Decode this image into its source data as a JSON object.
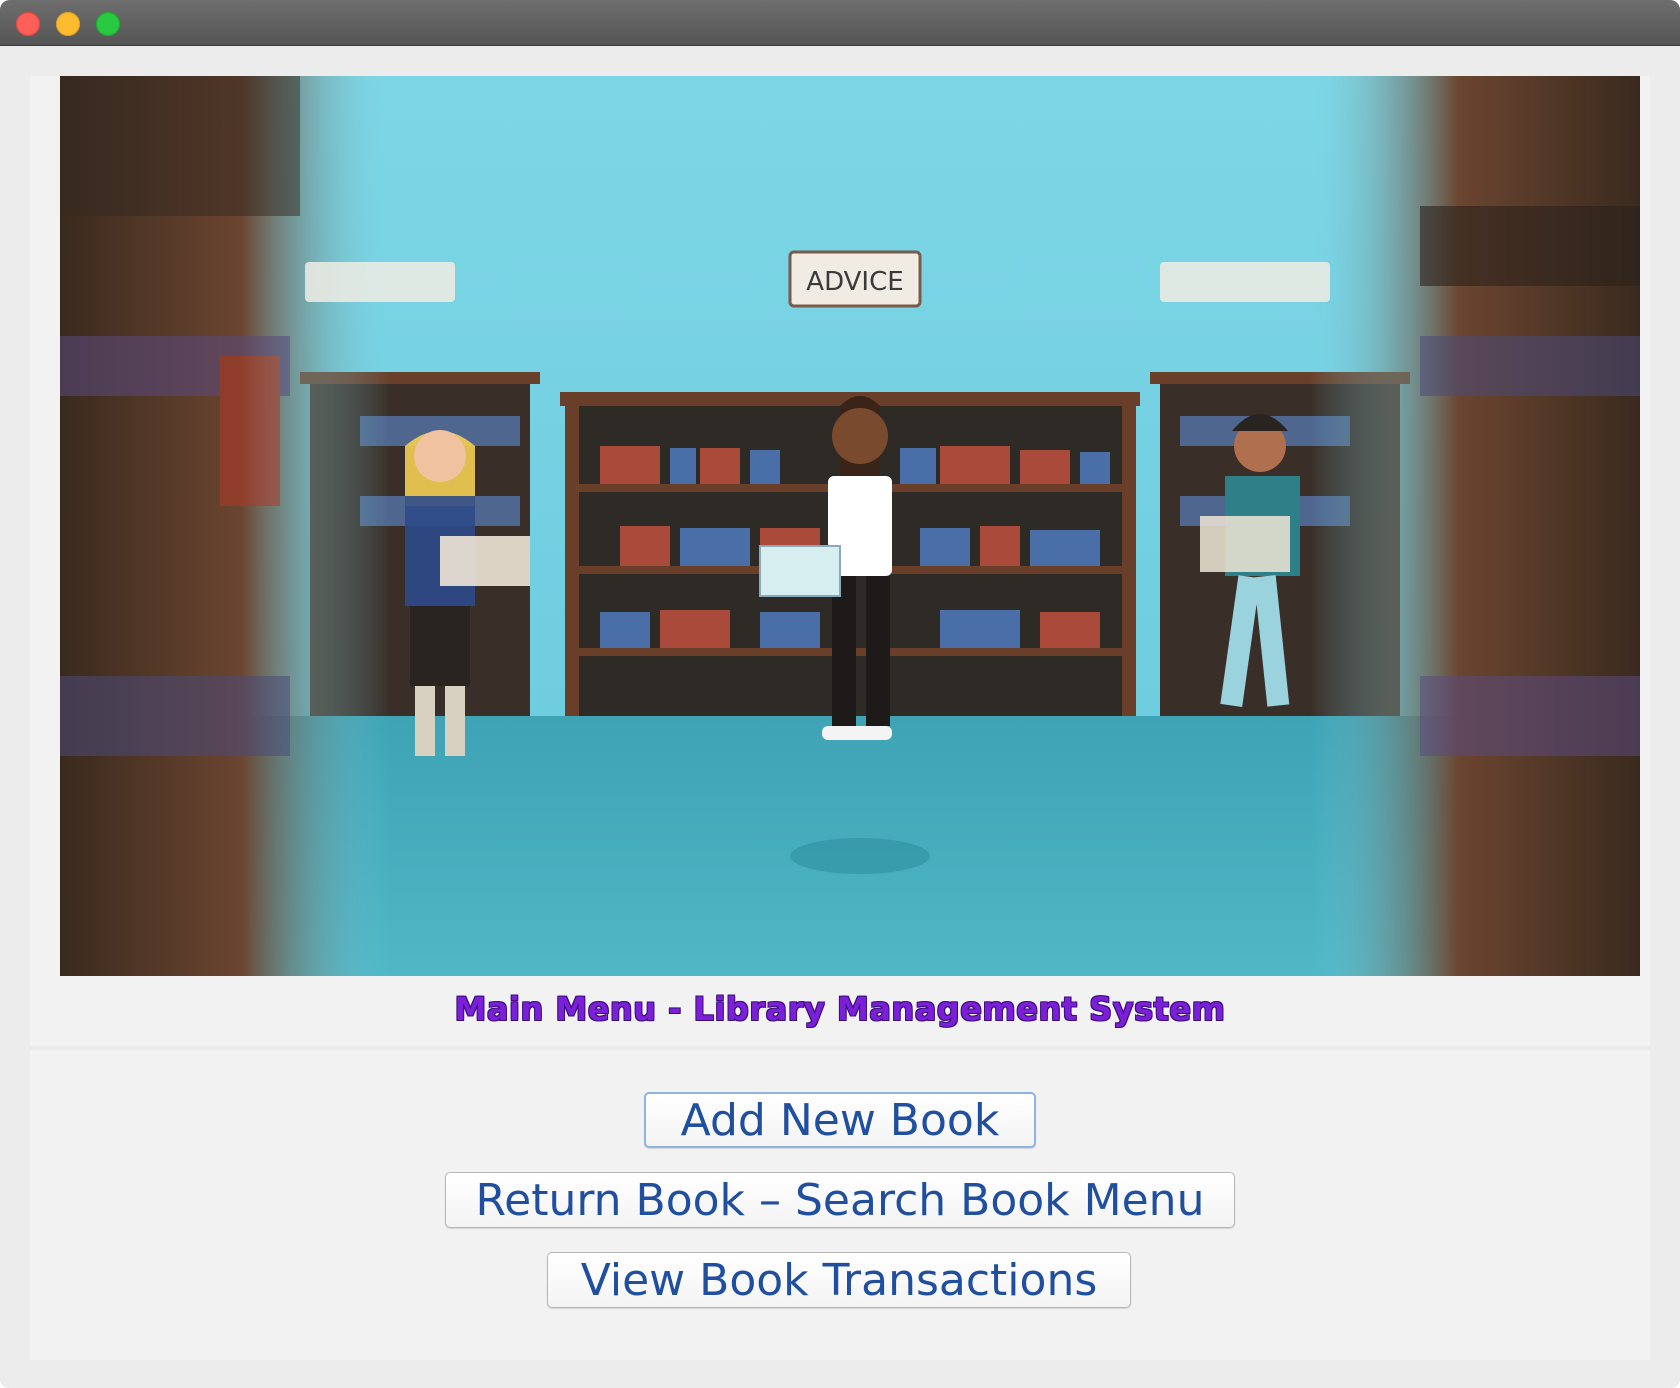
{
  "window": {
    "controls": [
      "close",
      "minimize",
      "maximize"
    ],
    "icons": {
      "close": "close-icon",
      "minimize": "minimize-icon",
      "maximize": "zoom-icon"
    }
  },
  "illustration": {
    "sign_center": "ADVICE"
  },
  "main": {
    "title": "Main Menu - Library Management System",
    "title_color": "#7b1fd8"
  },
  "buttons": {
    "add_new_book": "Add New Book",
    "return_book": "Return Book – Search Book Menu",
    "view_transactions": "View Book Transactions",
    "text_color": "#1f4f9e"
  }
}
